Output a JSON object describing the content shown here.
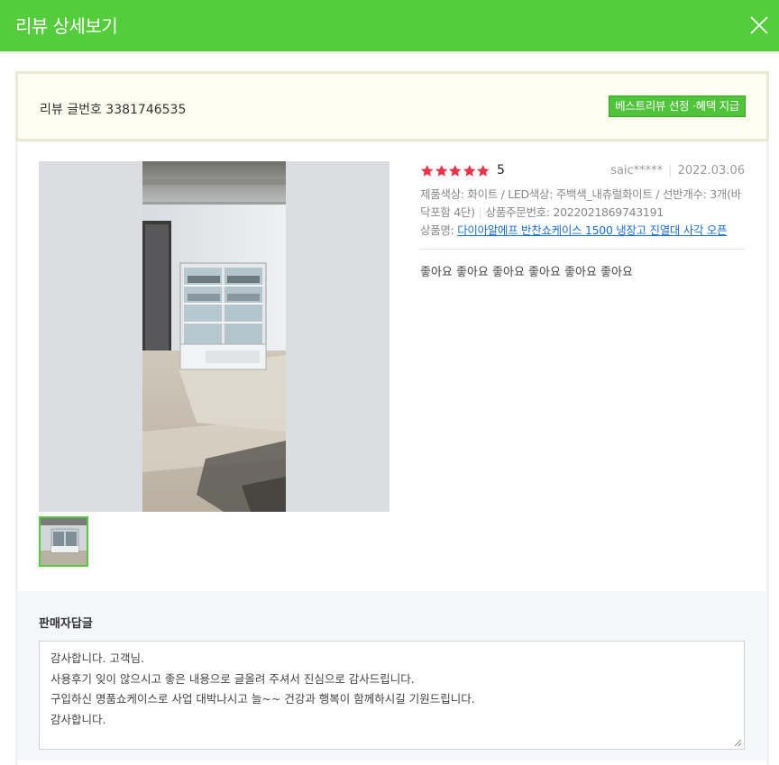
{
  "header": {
    "title": "리뷰 상세보기"
  },
  "review_number": {
    "label": "리뷰 글번호 3381746535",
    "best_button_label": "베스트리뷰 선정 ·혜택 지급"
  },
  "review": {
    "rating": 5,
    "rating_text": "5",
    "user": "saic*****",
    "date": "2022.03.06",
    "options": "제품색상: 화이트 / LED색상: 주백색_내츄럴화이트 / 선반개수: 3개(바닥포함 4단)",
    "order_number": "상품주문번호: 2022021869743191",
    "product_label": "상품명: ",
    "product_name": "다이아알에프 반찬쇼케이스 1500 냉장고 진열대 사각 오픈",
    "content": "좋아요 좋아요 좋아요 좋아요 좋아요 좋아요"
  },
  "reply": {
    "title": "판매자답글",
    "lines": [
      "감사합니다. 고객님.",
      "사용후기 잊이 않으시고 좋은 내용으로 글올려 주셔서 진심으로 감사드립니다.",
      "구입하신 명품쇼케이스로 사업 대박나시고 늘~~ 건강과 행복이 함께하시길 기원드립니다.",
      "감사합니다."
    ]
  },
  "colors": {
    "accent": "#55cc3c",
    "star": "#e8334a",
    "link": "#1a6fd1"
  },
  "icons": {
    "close": "close-icon",
    "star": "star-icon"
  }
}
